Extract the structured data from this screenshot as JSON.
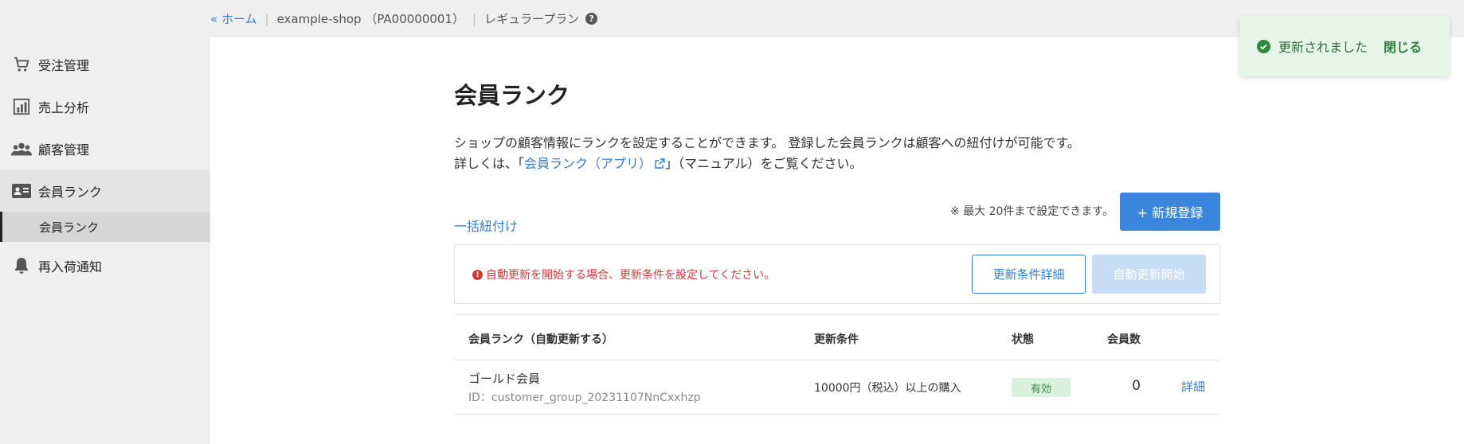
{
  "breadcrumb": {
    "home": "« ホーム",
    "shop": "example-shop （PA00000001）",
    "plan": "レギュラープラン",
    "help_icon": "question-circle-icon",
    "help_glyph": "?"
  },
  "sidebar": {
    "items": [
      {
        "label": "受注管理",
        "icon": "cart-icon"
      },
      {
        "label": "売上分析",
        "icon": "chart-icon"
      },
      {
        "label": "顧客管理",
        "icon": "users-icon"
      },
      {
        "label": "会員ランク",
        "icon": "id-card-icon"
      },
      {
        "label": "再入荷通知",
        "icon": "bell-icon"
      }
    ],
    "sub_item": "会員ランク"
  },
  "page": {
    "title": "会員ランク",
    "desc_line1": "ショップの顧客情報にランクを設定することができます。 登録した会員ランクは顧客への紐付けが可能です。",
    "desc_line2_pre": "詳しくは、「",
    "desc_link": "会員ランク（アプリ）",
    "desc_line2_post": "」（マニュアル）をご覧ください。",
    "bulk_link": "一括紐付け",
    "limit_note": "※ 最大 20件まで設定できます。",
    "new_button": "+ 新規登録"
  },
  "warning": {
    "text": "自動更新を開始する場合、更新条件を設定してください。",
    "icon_glyph": "!",
    "cond_button": "更新条件詳細",
    "auto_button": "自動更新開始"
  },
  "table": {
    "headers": [
      "会員ランク（自動更新する）",
      "更新条件",
      "状態",
      "会員数"
    ],
    "rows": [
      {
        "name": "ゴールド会員",
        "id": "ID：customer_group_20231107NnCxxhzp",
        "condition": "10000円（税込）以上の購入",
        "status": "有効",
        "count": "0",
        "detail": "詳細"
      }
    ]
  },
  "toast": {
    "message": "更新されました",
    "close": "閉じる"
  },
  "colors": {
    "accent": "#3a86dc",
    "link": "#2f7fd4",
    "error": "#d23a3a",
    "success": "#2e8a3c"
  }
}
